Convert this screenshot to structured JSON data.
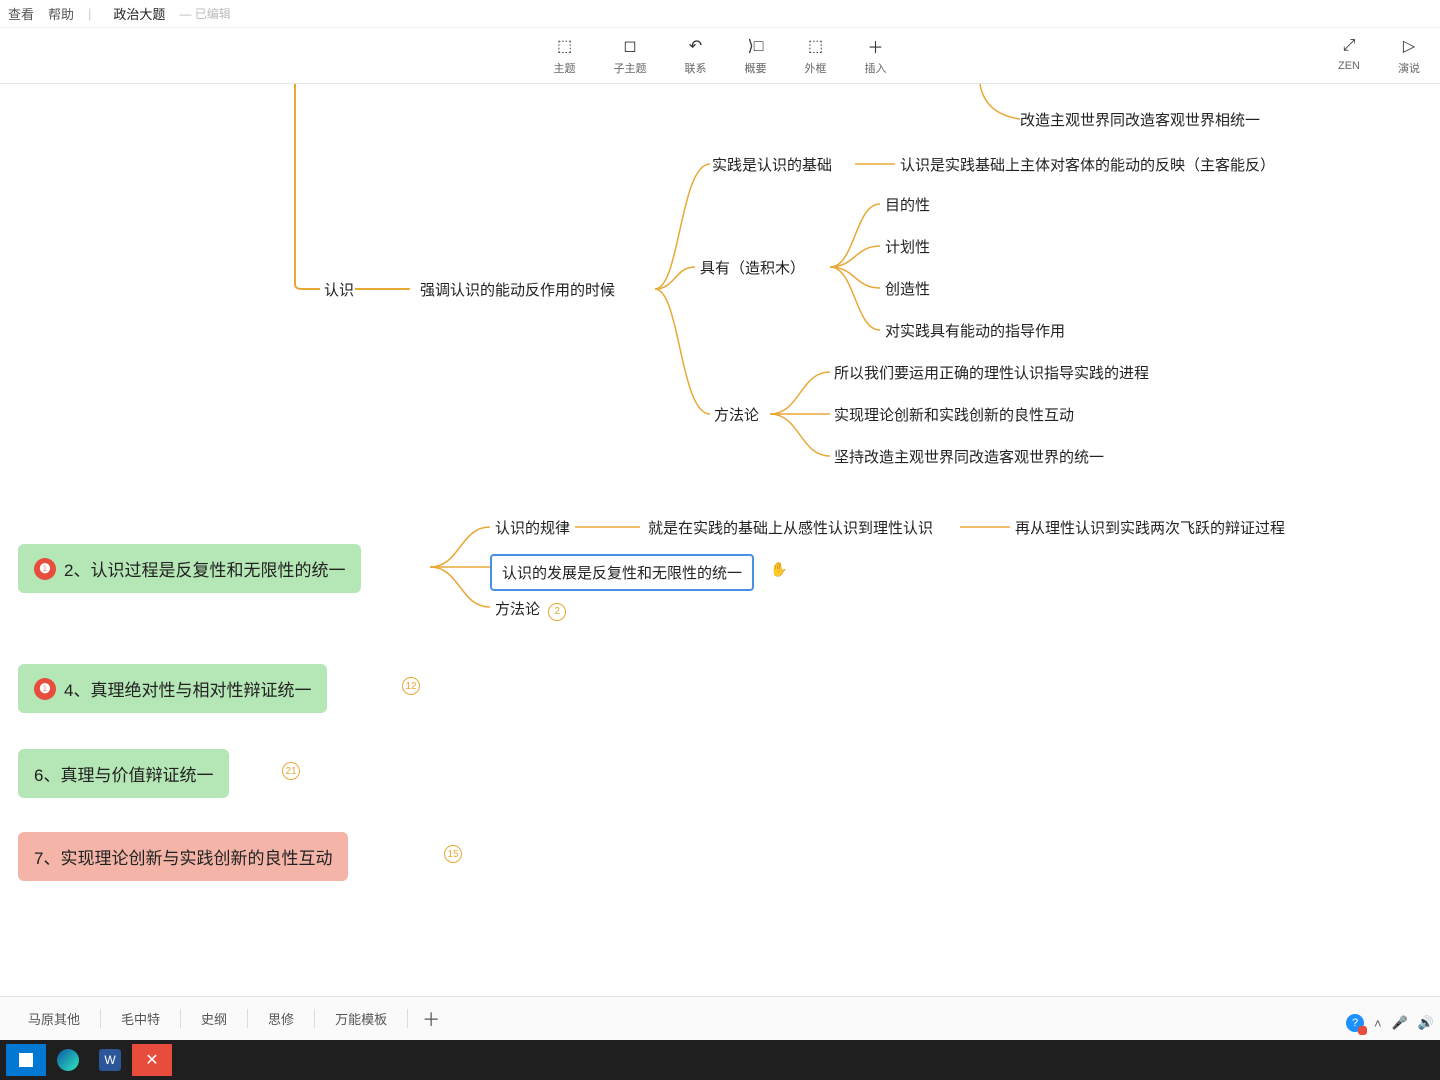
{
  "header": {
    "view": "查看",
    "help": "帮助",
    "title": "政治大题",
    "edited": "— 已编辑"
  },
  "toolbar": {
    "center": [
      {
        "icon": "⬚",
        "label": "主题"
      },
      {
        "icon": "◻",
        "label": "子主题"
      },
      {
        "icon": "↶",
        "label": "联系"
      },
      {
        "icon": "⟩□",
        "label": "概要"
      },
      {
        "icon": "⬚",
        "label": "外框"
      },
      {
        "icon": "＋",
        "label": "插入"
      }
    ],
    "right": [
      {
        "icon": "⤢",
        "label": "ZEN"
      },
      {
        "icon": "▷",
        "label": "演说"
      }
    ]
  },
  "mindmap": {
    "floating_top": "改造主观世界同改造客观世界相统一",
    "root": "认识",
    "root_child": "强调认识的能动反作用的时候",
    "branch1": {
      "label": "实践是认识的基础",
      "child": "认识是实践基础上主体对客体的能动的反映（主客能反）"
    },
    "branch2": {
      "label": "具有（造积木）",
      "children": [
        "目的性",
        "计划性",
        "创造性",
        "对实践具有能动的指导作用"
      ]
    },
    "branch3": {
      "label": "方法论",
      "children": [
        "所以我们要运用正确的理性认识指导实践的进程",
        "实现理论创新和实践创新的良性互动",
        "坚持改造主观世界同改造客观世界的统一"
      ]
    },
    "section2": {
      "title": "2、认识过程是反复性和无限性的统一",
      "children": [
        {
          "label": "认识的规律",
          "sub1": "就是在实践的基础上从感性认识到理性认识",
          "sub2": "再从理性认识到实践两次飞跃的辩证过程"
        },
        {
          "label": "认识的发展是反复性和无限性的统一",
          "selected": true
        },
        {
          "label": "方法论",
          "count": "2"
        }
      ]
    },
    "section4": {
      "title": "4、真理绝对性与相对性辩证统一",
      "count": "12"
    },
    "section6": {
      "title": "6、真理与价值辩证统一",
      "count": "21"
    },
    "section7": {
      "title": "7、实现理论创新与实践创新的良性互动",
      "count": "15"
    }
  },
  "bottom_tabs": [
    "马原其他",
    "毛中特",
    "史纲",
    "思修",
    "万能模板"
  ]
}
